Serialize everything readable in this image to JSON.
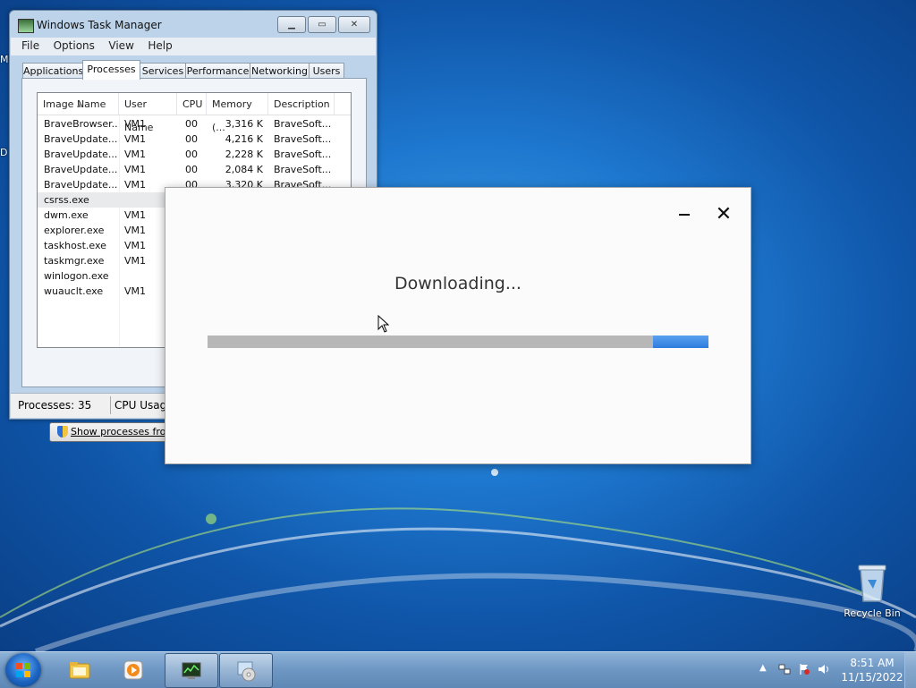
{
  "desktop": {
    "edge_letters": [
      "M",
      "D"
    ],
    "recycle_bin_label": "Recycle Bin"
  },
  "task_manager": {
    "title": "Windows Task Manager",
    "caption_min": "▁",
    "caption_max": "▭",
    "caption_close": "✕",
    "menus": [
      "File",
      "Options",
      "View",
      "Help"
    ],
    "tabs": [
      "Applications",
      "Processes",
      "Services",
      "Performance",
      "Networking",
      "Users"
    ],
    "active_tab": "Processes",
    "columns": [
      "Image Name",
      "User Name",
      "CPU",
      "Memory (...",
      "Description"
    ],
    "rows": [
      {
        "image": "BraveBrowser...",
        "user": "VM1",
        "cpu": "00",
        "memory": "3,316 K",
        "desc": "BraveSoft..."
      },
      {
        "image": "BraveUpdate....",
        "user": "VM1",
        "cpu": "00",
        "memory": "4,216 K",
        "desc": "BraveSoft..."
      },
      {
        "image": "BraveUpdate....",
        "user": "VM1",
        "cpu": "00",
        "memory": "2,228 K",
        "desc": "BraveSoft..."
      },
      {
        "image": "BraveUpdate....",
        "user": "VM1",
        "cpu": "00",
        "memory": "2,084 K",
        "desc": "BraveSoft..."
      },
      {
        "image": "BraveUpdate....",
        "user": "VM1",
        "cpu": "00",
        "memory": "3,320 K",
        "desc": "BraveSoft..."
      },
      {
        "image": "csrss.exe",
        "user": "",
        "cpu": "",
        "memory": "",
        "desc": ""
      },
      {
        "image": "dwm.exe",
        "user": "VM1",
        "cpu": "",
        "memory": "",
        "desc": ""
      },
      {
        "image": "explorer.exe",
        "user": "VM1",
        "cpu": "",
        "memory": "",
        "desc": ""
      },
      {
        "image": "taskhost.exe",
        "user": "VM1",
        "cpu": "",
        "memory": "",
        "desc": ""
      },
      {
        "image": "taskmgr.exe",
        "user": "VM1",
        "cpu": "",
        "memory": "",
        "desc": ""
      },
      {
        "image": "winlogon.exe",
        "user": "",
        "cpu": "",
        "memory": "",
        "desc": ""
      },
      {
        "image": "wuauclt.exe",
        "user": "VM1",
        "cpu": "",
        "memory": "",
        "desc": ""
      }
    ],
    "selected_row": 5,
    "show_processes_button": "Show processes from all",
    "status_processes": "Processes: 35",
    "status_cpu": "CPU Usage"
  },
  "download_dialog": {
    "message": "Downloading...",
    "close_glyph": "✕",
    "progress_indeterminate_start": 0.89,
    "progress_indeterminate_width": 0.11,
    "progress_color": "#2d7bdd"
  },
  "taskbar": {
    "pinned": [
      {
        "name": "explorer-folder-icon",
        "active": false
      },
      {
        "name": "media-player-icon",
        "active": false
      },
      {
        "name": "task-manager-icon",
        "active": true
      },
      {
        "name": "installer-cd-icon",
        "active": true
      }
    ],
    "tray_arrow": "▲",
    "time": "8:51 AM",
    "date": "11/15/2022"
  }
}
